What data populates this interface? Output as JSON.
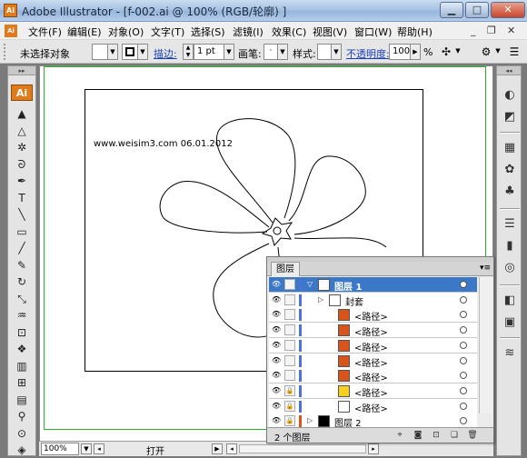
{
  "window": {
    "title": "Adobe Illustrator - [f-002.ai @ 100% (RGB/轮廓) ]",
    "app_badge": "Ai"
  },
  "menubar": {
    "items": [
      "文件(F)",
      "编辑(E)",
      "对象(O)",
      "文字(T)",
      "选择(S)",
      "滤镜(I)",
      "效果(C)",
      "视图(V)",
      "窗口(W)",
      "帮助(H)"
    ]
  },
  "controlbar": {
    "selection_status": "未选择对象",
    "stroke_link": "描边:",
    "stroke_weight": "1 pt",
    "brush_label": "画笔:",
    "style_label": "样式:",
    "opacity_link": "不透明度:",
    "opacity_value": "100",
    "opacity_unit": "%"
  },
  "toolbox": {
    "logo": "Ai",
    "tools": [
      {
        "name": "selection-tool-icon",
        "glyph": "▲"
      },
      {
        "name": "direct-selection-tool-icon",
        "glyph": "△"
      },
      {
        "name": "magic-wand-tool-icon",
        "glyph": "✲"
      },
      {
        "name": "lasso-tool-icon",
        "glyph": "ᘐ"
      },
      {
        "name": "pen-tool-icon",
        "glyph": "✒"
      },
      {
        "name": "type-tool-icon",
        "glyph": "T"
      },
      {
        "name": "line-tool-icon",
        "glyph": "╲"
      },
      {
        "name": "rectangle-tool-icon",
        "glyph": "▭"
      },
      {
        "name": "paintbrush-tool-icon",
        "glyph": "╱"
      },
      {
        "name": "pencil-tool-icon",
        "glyph": "✎"
      },
      {
        "name": "rotate-tool-icon",
        "glyph": "↻"
      },
      {
        "name": "scale-tool-icon",
        "glyph": "⤡"
      },
      {
        "name": "warp-tool-icon",
        "glyph": "♒"
      },
      {
        "name": "free-transform-tool-icon",
        "glyph": "⊡"
      },
      {
        "name": "symbol-sprayer-tool-icon",
        "glyph": "❖"
      },
      {
        "name": "graph-tool-icon",
        "glyph": "▥"
      },
      {
        "name": "mesh-tool-icon",
        "glyph": "⊞"
      },
      {
        "name": "gradient-tool-icon",
        "glyph": "▤"
      },
      {
        "name": "eyedropper-tool-icon",
        "glyph": "⚲"
      },
      {
        "name": "blend-tool-icon",
        "glyph": "⊙"
      },
      {
        "name": "live-paint-tool-icon",
        "glyph": "◈"
      }
    ]
  },
  "canvas": {
    "watermark": "www.weisim3.com 06.01.2012",
    "artboard_accent": "#2bb02b"
  },
  "statusbar": {
    "zoom": "100%",
    "status_text": "打开"
  },
  "layers_panel": {
    "tab": "图层",
    "rows": [
      {
        "label": "图层 1",
        "kind": "layer",
        "selected": true,
        "thumb": "#ffffff",
        "bar": "#4a72d8"
      },
      {
        "label": "封套",
        "kind": "group",
        "selected": false,
        "thumb": "#ffffff",
        "bar": "#4a72d8"
      },
      {
        "label": "<路径>",
        "kind": "path",
        "selected": false,
        "thumb": "#d9541a",
        "bar": "#4a72d8"
      },
      {
        "label": "<路径>",
        "kind": "path",
        "selected": false,
        "thumb": "#d9541a",
        "bar": "#4a72d8"
      },
      {
        "label": "<路径>",
        "kind": "path",
        "selected": false,
        "thumb": "#d9541a",
        "bar": "#4a72d8"
      },
      {
        "label": "<路径>",
        "kind": "path",
        "selected": false,
        "thumb": "#d9541a",
        "bar": "#4a72d8"
      },
      {
        "label": "<路径>",
        "kind": "path",
        "selected": false,
        "thumb": "#d9541a",
        "bar": "#4a72d8"
      },
      {
        "label": "<路径>",
        "kind": "path",
        "selected": false,
        "thumb": "#f5d020",
        "bar": "#4a72d8"
      },
      {
        "label": "<路径>",
        "kind": "path",
        "selected": false,
        "thumb": "#ffffff",
        "bar": "#4a72d8"
      },
      {
        "label": "图层 2",
        "kind": "layer",
        "selected": false,
        "thumb": "#000000",
        "bar": "#d9541a"
      }
    ],
    "footer_status": "2 个图层"
  }
}
